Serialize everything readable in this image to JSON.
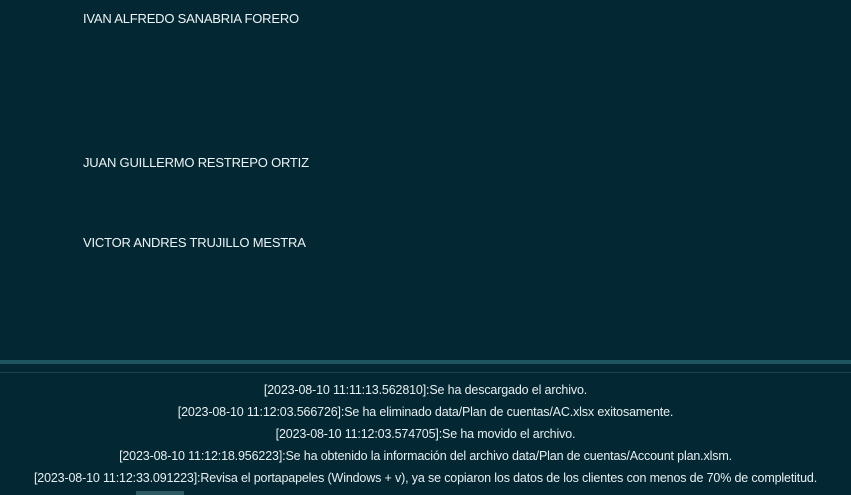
{
  "names": [
    "IVAN ALFREDO SANABRIA FORERO",
    "JUAN GUILLERMO RESTREPO ORTIZ",
    "VICTOR ANDRES TRUJILLO MESTRA"
  ],
  "log": [
    "[2023-08-10 11:11:13.562810]:Se ha descargado el archivo.",
    "[2023-08-10 11:12:03.566726]:Se ha eliminado data/Plan de cuentas/AC.xlsx exitosamente.",
    "[2023-08-10 11:12:03.574705]:Se ha movido el archivo.",
    "[2023-08-10 11:12:18.956223]:Se ha obtenido la información del archivo data/Plan de cuentas/Account plan.xlsm.",
    "[2023-08-10 11:12:33.091223]:Revisa el portapapeles (Windows + v), ya se copiaron los datos de los clientes con menos de 70% de completitud."
  ]
}
